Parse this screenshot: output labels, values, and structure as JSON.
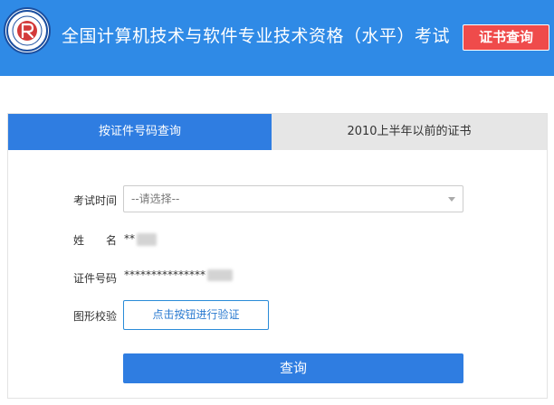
{
  "header": {
    "title": "全国计算机技术与软件专业技术资格（水平）考试",
    "cert_query_label": "证书查询",
    "logo_icon": "ruankao-logo-icon"
  },
  "tabs": [
    {
      "label": "按证件号码查询",
      "active": true
    },
    {
      "label": "2010上半年以前的证书",
      "active": false
    }
  ],
  "form": {
    "exam_time": {
      "label": "考试时间",
      "placeholder": "--请选择--"
    },
    "name": {
      "label_part1": "姓",
      "label_part2": "名",
      "value": "**"
    },
    "id_number": {
      "label": "证件号码",
      "value": "***************"
    },
    "captcha": {
      "label": "图形校验",
      "button_label": "点击按钮进行验证"
    },
    "submit_label": "查询"
  },
  "colors": {
    "header_bg": "#2f8ae6",
    "tab_active_bg": "#2f7de1",
    "tab_inactive_bg": "#e6e6e6",
    "cert_button_bg": "#ef4b4b",
    "primary_button": "#2f7de1"
  }
}
